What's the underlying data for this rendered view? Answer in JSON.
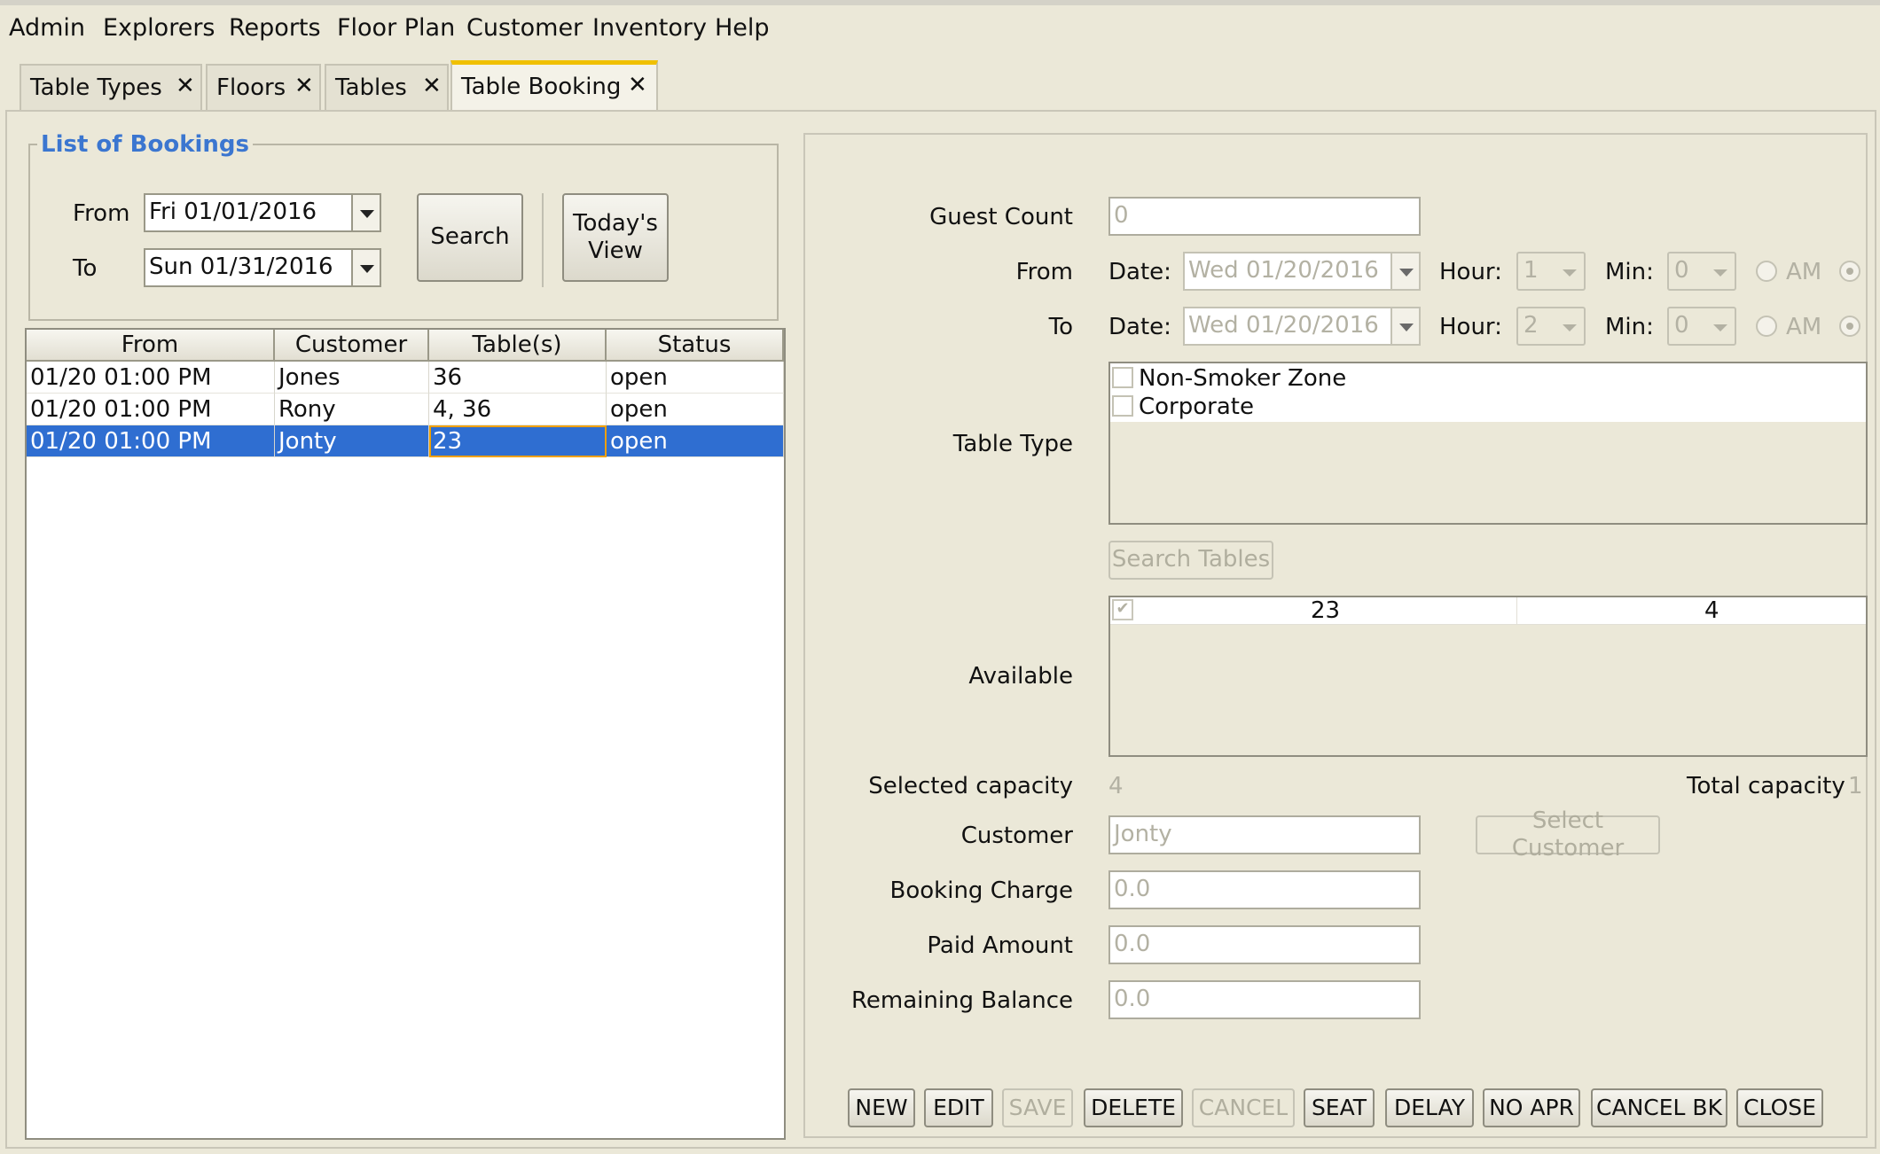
{
  "menu": [
    "Admin",
    "Explorers",
    "Reports",
    "Floor Plan",
    "Customer",
    "Inventory",
    "Help"
  ],
  "tabs": [
    {
      "label": "Table Types",
      "active": false
    },
    {
      "label": "Floors",
      "active": false
    },
    {
      "label": "Tables",
      "active": false
    },
    {
      "label": "Table Booking",
      "active": true
    }
  ],
  "bookings": {
    "title": "List of Bookings",
    "from_label": "From",
    "to_label": "To",
    "from_value": "Fri 01/01/2016",
    "to_value": "Sun 01/31/2016",
    "search_label": "Search",
    "todays_view_label": "Today's View",
    "columns": [
      "From",
      "Customer",
      "Table(s)",
      "Status"
    ],
    "rows": [
      [
        "01/20 01:00 PM",
        "Jones",
        "36",
        "open"
      ],
      [
        "01/20 01:00 PM",
        "Rony",
        "4, 36",
        "open"
      ],
      [
        "01/20 01:00 PM",
        "Jonty",
        "23",
        "open"
      ]
    ],
    "selected_row": 2
  },
  "form": {
    "guest_count_label": "Guest Count",
    "guest_count": "0",
    "from_label": "From",
    "to_label": "To",
    "date_label": "Date:",
    "hour_label": "Hour:",
    "min_label": "Min:",
    "am_label": "AM",
    "from_date": "Wed 01/20/2016",
    "from_hour": "1",
    "from_min": "0",
    "to_date": "Wed 01/20/2016",
    "to_hour": "2",
    "to_min": "0",
    "table_type_label": "Table Type",
    "table_types": [
      "Non-Smoker Zone",
      "Corporate"
    ],
    "search_tables_label": "Search Tables",
    "available_label": "Available",
    "available": [
      "23",
      "4"
    ],
    "selected_capacity_label": "Selected capacity",
    "selected_capacity": "4",
    "total_capacity_label": "Total capacity",
    "total_capacity": "1",
    "customer_label": "Customer",
    "customer": "Jonty",
    "select_customer_label": "Select Customer",
    "booking_charge_label": "Booking Charge",
    "booking_charge": "0.0",
    "paid_amount_label": "Paid Amount",
    "paid_amount": "0.0",
    "remaining_balance_label": "Remaining Balance",
    "remaining_balance": "0.0"
  },
  "buttons": [
    "NEW",
    "EDIT",
    "SAVE",
    "DELETE",
    "CANCEL",
    "SEAT",
    "DELAY",
    "NO APR",
    "CANCEL BK",
    "CLOSE"
  ]
}
